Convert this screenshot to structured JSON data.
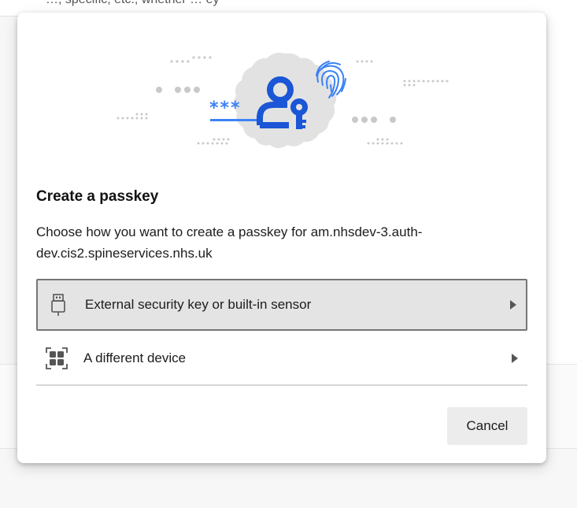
{
  "background": {
    "partial_text": "…, specific, etc., whether … ey"
  },
  "dialog": {
    "title": "Create a passkey",
    "description": "Choose how you want to create a passkey for am.nhsdev-3.auth-dev.cis2.spineservices.nhs.uk",
    "options": [
      {
        "label": "External security key or built-in sensor",
        "icon": "usb-security-key-icon",
        "selected": true
      },
      {
        "label": "A different device",
        "icon": "qr-code-device-icon",
        "selected": false
      }
    ],
    "cancel_label": "Cancel"
  },
  "illustration": {
    "masked_password": "***",
    "icons": [
      "person-key-icon",
      "fingerprint-icon"
    ]
  },
  "colors": {
    "accent": "#1a56d6",
    "light_accent": "#3b82f6",
    "badge_bg": "#e2e2e2",
    "selected_option_bg": "#e4e4e4",
    "selected_option_border": "#767676",
    "cancel_bg": "#ececec"
  }
}
